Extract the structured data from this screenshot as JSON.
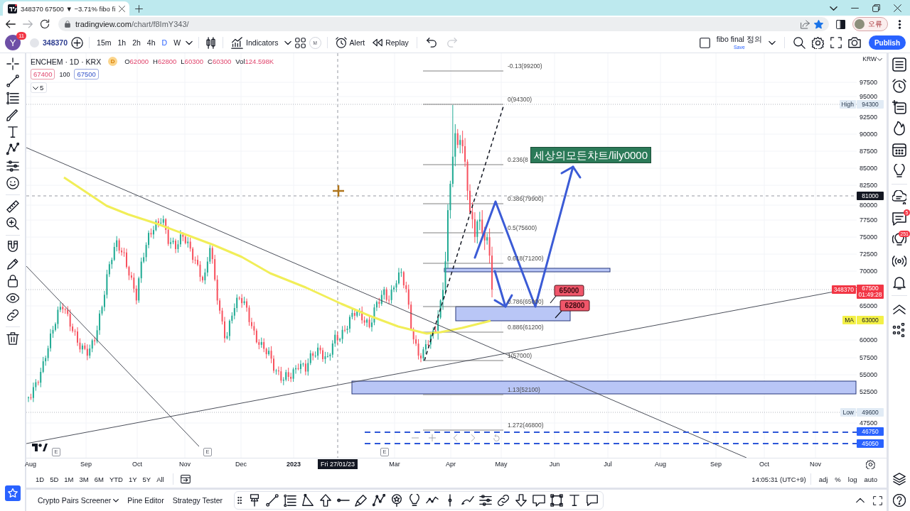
{
  "browser": {
    "tab": {
      "title": "348370 67500 ▼ −3.71% fibo fi"
    },
    "nav_buttons": [
      {
        "kind": "back",
        "disabled": false
      },
      {
        "kind": "forward",
        "disabled": true
      }
    ],
    "url": {
      "host": "tradingview.com",
      "path": "/chart/f8ImY343/"
    },
    "bookmarked": true,
    "profile": {
      "label": "오류"
    }
  },
  "toolbar": {
    "avatar": {
      "letter": "Y",
      "badge": "11"
    },
    "symbol": "348370",
    "intervals": [
      {
        "label": "15m",
        "selected": false
      },
      {
        "label": "1h",
        "selected": false
      },
      {
        "label": "2h",
        "selected": false
      },
      {
        "label": "4h",
        "selected": false
      },
      {
        "label": "D",
        "selected": true
      },
      {
        "label": "W",
        "selected": false
      }
    ],
    "indicators": "Indicators",
    "m_label": "M",
    "alert": "Alert",
    "replay": "Replay",
    "history": [
      {
        "kind": "undo",
        "disabled": false
      },
      {
        "kind": "redo",
        "disabled": true
      }
    ],
    "layout": {
      "name": "fibo final 정의",
      "save": "Save"
    },
    "publish": "Publish"
  },
  "legend": {
    "title": "ENCHEM · 1D · KRX",
    "badge": "D",
    "ohlc": [
      {
        "key": "O",
        "value": "62000"
      },
      {
        "key": "H",
        "value": "62800"
      },
      {
        "key": "L",
        "value": "60300"
      },
      {
        "key": "C",
        "value": "60300"
      },
      {
        "key": "Vol",
        "value": "124.598K"
      }
    ],
    "bid": "67400",
    "spread": "100",
    "ask": "67500",
    "collapsed_count": "5"
  },
  "chart": {
    "fib_levels": [
      "-0.13(99200)",
      "0(94300)",
      "0.236(8",
      "0.386(79900)",
      "0.5(75600)",
      "0.618(71200)",
      "0.786(65000)",
      "0.886(61200)",
      "1(57000)",
      "1.13(52100)",
      "1.272(46800)"
    ],
    "note": "세상의모든챠트/lily0000",
    "callouts": [
      "65000",
      "62800"
    ],
    "earnings_markers": [
      "E",
      "E",
      "E"
    ]
  },
  "price_axis": {
    "currency": "KRW",
    "ticks": [
      "97500",
      "95000",
      "92500",
      "90000",
      "87500",
      "85000",
      "82500",
      "80000",
      "77500",
      "75000",
      "72500",
      "70000",
      "65000",
      "60000",
      "57500",
      "55000",
      "52500",
      "47500"
    ]
  },
  "price_tags": [
    {
      "kind": "high",
      "label": "High",
      "value": "94300"
    },
    {
      "kind": "crosshair",
      "value": "81000"
    },
    {
      "kind": "last",
      "label": "348370",
      "value": "67500",
      "countdown": "01:49:28"
    },
    {
      "kind": "ma",
      "label": "MA",
      "value": "63000"
    },
    {
      "kind": "low",
      "label": "Low",
      "value": "49600"
    },
    {
      "kind": "line",
      "value": "46750"
    },
    {
      "kind": "line",
      "value": "45050"
    }
  ],
  "time_axis": {
    "labels": [
      {
        "label": "Aug",
        "kind": "month"
      },
      {
        "label": "Sep",
        "kind": "month"
      },
      {
        "label": "Oct",
        "kind": "month"
      },
      {
        "label": "Nov",
        "kind": "month"
      },
      {
        "label": "Dec",
        "kind": "month"
      },
      {
        "label": "2023",
        "kind": "year"
      },
      {
        "label": "Mar",
        "kind": "month"
      },
      {
        "label": "Apr",
        "kind": "month"
      },
      {
        "label": "May",
        "kind": "month"
      },
      {
        "label": "Jun",
        "kind": "month"
      },
      {
        "label": "Jul",
        "kind": "month"
      },
      {
        "label": "Aug",
        "kind": "month"
      },
      {
        "label": "Sep",
        "kind": "month"
      },
      {
        "label": "Oct",
        "kind": "month"
      },
      {
        "label": "Nov",
        "kind": "month"
      }
    ],
    "cursor": "Fri 27/01/23"
  },
  "ranges": [
    "1D",
    "5D",
    "1M",
    "3M",
    "6M",
    "YTD",
    "1Y",
    "5Y",
    "All"
  ],
  "clock": "14:05:31 (UTC+9)",
  "scale_options": [
    "adj",
    "%",
    "log",
    "auto"
  ],
  "bottom_tabs": [
    {
      "label": "Crypto Pairs Screener",
      "dropdown": true
    },
    {
      "label": "Pine Editor",
      "dropdown": false
    },
    {
      "label": "Strategy Tester",
      "dropdown": false
    }
  ],
  "right_sidebar": {
    "chat_badge": "5",
    "ideas_badge": "251"
  }
}
